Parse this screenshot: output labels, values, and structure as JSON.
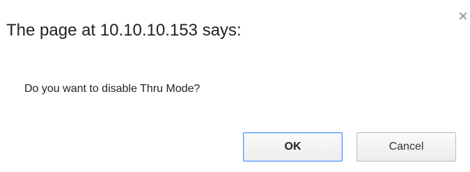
{
  "dialog": {
    "title": "The page at 10.10.10.153 says:",
    "message": "Do you want to disable Thru Mode?",
    "close_icon": "close-icon",
    "buttons": {
      "ok_label": "OK",
      "cancel_label": "Cancel"
    }
  },
  "colors": {
    "focus_border": "#4d90fe",
    "text": "#222222",
    "background": "#ffffff"
  }
}
